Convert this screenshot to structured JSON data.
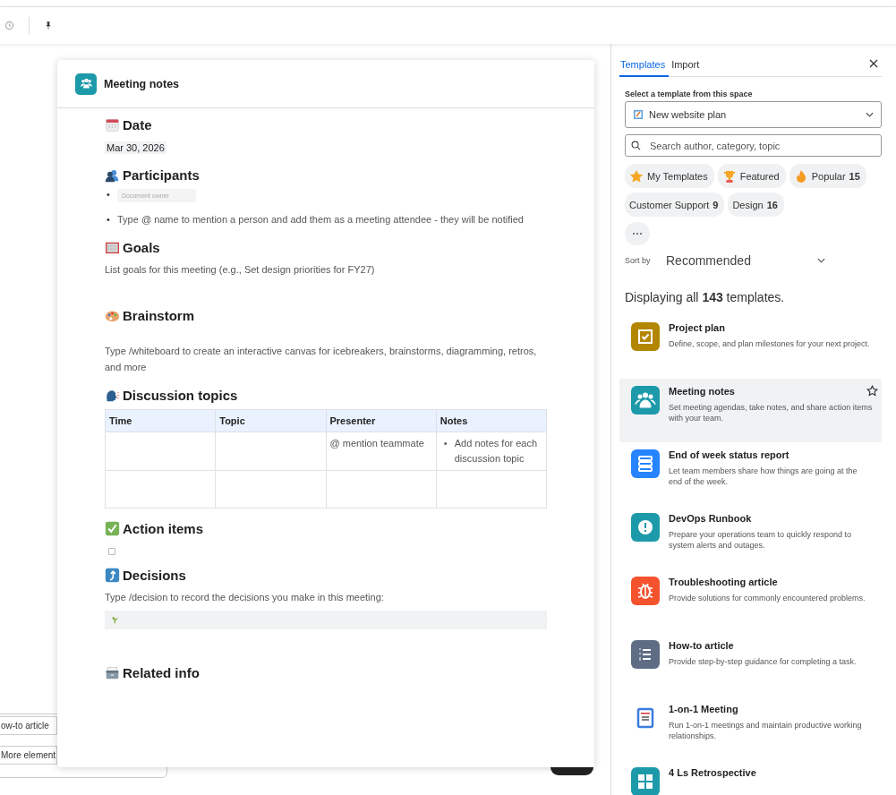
{
  "background_buttons": [
    {
      "label": "ow-to article"
    },
    {
      "label": "More element"
    }
  ],
  "document": {
    "title": "Meeting notes",
    "sections": [
      {
        "heading": "Date",
        "blocks": [
          {
            "kind": "date",
            "text": "Mar 30, 2026"
          }
        ]
      },
      {
        "heading": "Participants",
        "blocks": [
          {
            "kind": "bullets",
            "items": [
              {
                "kind": "chip",
                "marker": "•",
                "text": "Document owner"
              },
              {
                "kind": "text",
                "marker": "•",
                "text": "Type @ name to mention a person and add them as a meeting attendee - they will be notified"
              }
            ]
          }
        ]
      },
      {
        "heading": "Goals",
        "blocks": [
          {
            "kind": "paragraph",
            "text": "List goals for this meeting (e.g., Set design priorities for FY27)"
          }
        ]
      },
      {
        "heading": "Brainstorm",
        "blocks": [
          {
            "kind": "paragraph",
            "text": "Type /whiteboard to create an interactive canvas for icebreakers, brainstorms, diagramming, retros, and more"
          }
        ]
      },
      {
        "heading": "Discussion topics",
        "blocks": [
          {
            "kind": "table",
            "columns": [
              "Time",
              "Topic",
              "Presenter",
              "Notes"
            ],
            "rows": [
              {
                "cells": [
                  {},
                  {},
                  {
                    "text": "@ mention teammate"
                  },
                  {
                    "bullets": [
                      {
                        "marker": "•",
                        "text": "Add notes for each discussion topic"
                      }
                    ]
                  }
                ]
              },
              {
                "cells": [
                  {},
                  {},
                  {},
                  {}
                ]
              }
            ]
          }
        ]
      },
      {
        "heading": "Action items",
        "blocks": [
          {
            "kind": "checkbox",
            "checked": false
          }
        ]
      },
      {
        "heading": "Decisions",
        "blocks": [
          {
            "kind": "paragraph",
            "text": "Type /decision to record the decisions you make in this meeting:"
          },
          {
            "kind": "decision"
          }
        ]
      },
      {
        "heading": "Related info"
      }
    ]
  },
  "panel": {
    "tabs": [
      {
        "label": "Templates",
        "selected": true
      },
      {
        "label": "Import",
        "selected": false
      }
    ],
    "space_label": "Select a template from this space",
    "space_select": {
      "value": "New website plan"
    },
    "search": {
      "placeholder": "Search author, category, topic"
    },
    "filters": [
      {
        "label": "My Templates"
      },
      {
        "label": "Featured"
      },
      {
        "label": "Popular",
        "count": "15"
      },
      {
        "label": "Customer Support",
        "count": "9"
      },
      {
        "label": "Design",
        "count": "16"
      }
    ],
    "more_button": "⋯",
    "sort": {
      "label": "Sort by",
      "value": "Recommended"
    },
    "summary": "Displaying all **143** templates.",
    "templates": [
      {
        "title": "Project plan",
        "description": "Define, scope, and plan milestones for your next project.",
        "color": "#b38600",
        "selected": false
      },
      {
        "title": "Meeting notes",
        "description": "Set meeting agendas, take notes, and share action items with your team.",
        "color": "#1d9aaa",
        "selected": true
      },
      {
        "title": "End of week status report",
        "description": "Let team members share how things are going at the end of the week.",
        "color": "#2684ff",
        "selected": false
      },
      {
        "title": "DevOps Runbook",
        "description": "Prepare your operations team to quickly respond to system alerts and outages.",
        "color": "#1d9aaa",
        "selected": false
      },
      {
        "title": "Troubleshooting article",
        "description": "Provide solutions for commonly encountered problems.",
        "color": "#f4532e",
        "selected": false
      },
      {
        "title": "How-to article",
        "description": "Provide step-by-step guidance for completing a task.",
        "color": "#5e6c84",
        "selected": false
      },
      {
        "title": "1-on-1 Meeting",
        "description": "Run 1-on-1 meetings and maintain productive working relationships.",
        "color": "#3b7de0",
        "selected": false
      },
      {
        "title": "4 Ls Retrospective",
        "color": "#1d9aaa",
        "selected": false
      }
    ]
  }
}
